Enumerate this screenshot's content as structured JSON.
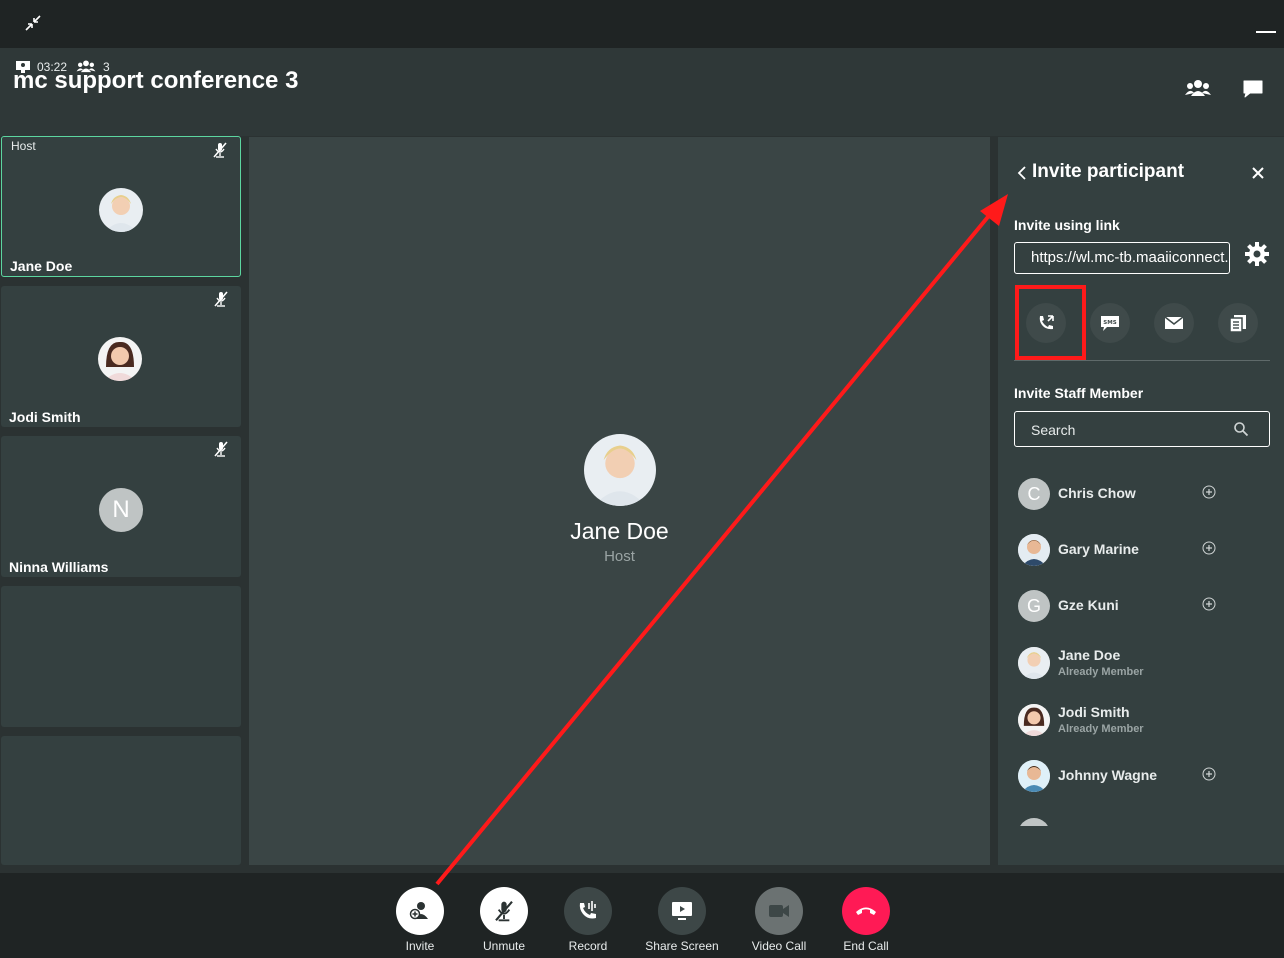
{
  "window": {
    "collapse_icon": "collapse-arrows-icon",
    "minimize_icon": "minimize-icon"
  },
  "header": {
    "title": "mc support conference 3",
    "duration": "03:22",
    "participants_count": "3",
    "participants_icon": "participants-icon",
    "chat_icon": "chat-icon"
  },
  "tiles": [
    {
      "tag": "Host",
      "name": "Jane Doe",
      "muted": true
    },
    {
      "tag": "",
      "name": "Jodi Smith",
      "muted": true
    },
    {
      "tag": "",
      "name": "Ninna Williams",
      "initial": "N",
      "muted": true
    }
  ],
  "stage": {
    "name": "Jane Doe",
    "role": "Host"
  },
  "panel": {
    "title": "Invite participant",
    "invite_link_label": "Invite using link",
    "link_value": "https://wl.mc-tb.maaiiconnect.com/j/abc",
    "share_options": [
      "phone-call-icon",
      "sms-icon",
      "email-icon",
      "copy-icon"
    ],
    "staff_label": "Invite Staff Member",
    "search_placeholder": "Search",
    "staff": [
      {
        "name": "Chris Chow",
        "initial": "C",
        "status": ""
      },
      {
        "name": "Gary Marine",
        "initial": "",
        "status": ""
      },
      {
        "name": "Gze Kuni",
        "initial": "G",
        "status": ""
      },
      {
        "name": "Jane Doe",
        "initial": "",
        "status": "Already Member"
      },
      {
        "name": "Jodi Smith",
        "initial": "",
        "status": "Already Member"
      },
      {
        "name": "Johnny Wagne",
        "initial": "",
        "status": ""
      }
    ]
  },
  "controls": [
    {
      "label": "Invite",
      "icon": "invite-icon"
    },
    {
      "label": "Unmute",
      "icon": "mic-off-icon"
    },
    {
      "label": "Record",
      "icon": "record-icon"
    },
    {
      "label": "Share Screen",
      "icon": "share-screen-icon"
    },
    {
      "label": "Video Call",
      "icon": "video-icon"
    },
    {
      "label": "End Call",
      "icon": "end-call-icon"
    }
  ],
  "colors": {
    "accent_green": "#5cd6a0",
    "end_call": "#ff1a55",
    "highlight": "#ff1a1a"
  }
}
